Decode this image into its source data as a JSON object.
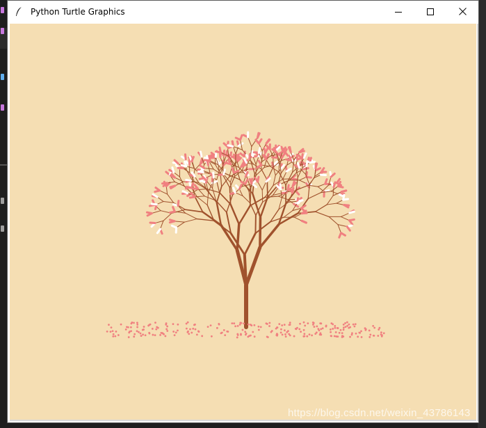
{
  "window": {
    "title": "Python Turtle Graphics",
    "controls": {
      "minimize": "minimize-icon",
      "maximize": "maximize-icon",
      "close": "close-icon"
    }
  },
  "canvas": {
    "background_color": "#f5deb3",
    "branch_color": "#a0522d",
    "blossom_color": "#f08080",
    "highlight_color": "#ffffff"
  },
  "watermark": "https://blog.csdn.net/weixin_43786143"
}
